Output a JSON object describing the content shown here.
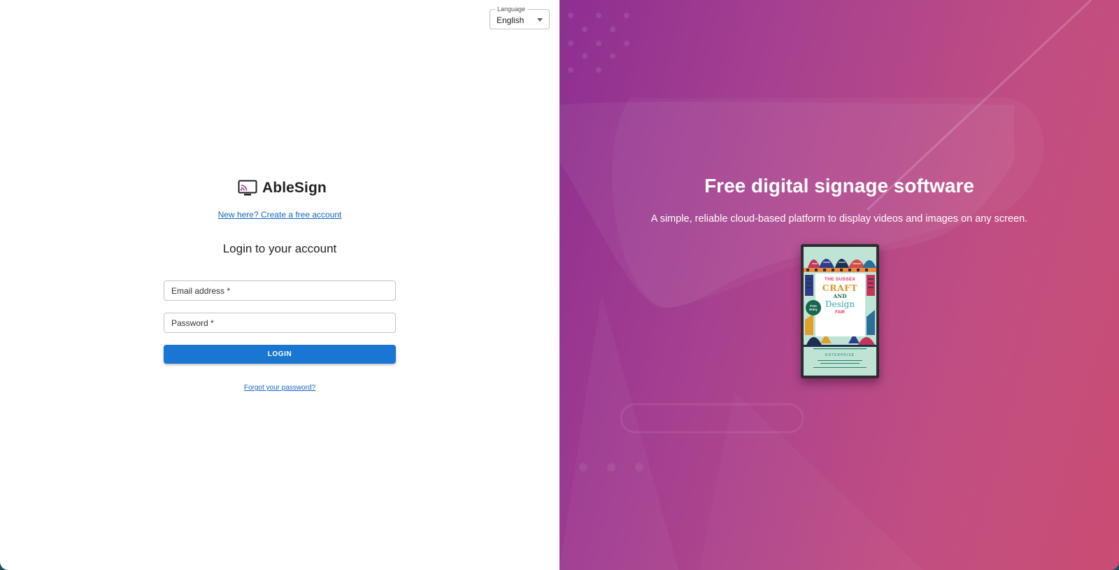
{
  "language": {
    "legend": "Language",
    "selected": "English"
  },
  "brand": {
    "name": "AbleSign",
    "icon": "cast-screen-icon"
  },
  "login": {
    "signup_link": "New here? Create a free account",
    "title": "Login to your account",
    "email_placeholder": "Email address *",
    "password_placeholder": "Password *",
    "button_label": "LOGIN",
    "forgot_link": "Forgot your password?"
  },
  "hero": {
    "title": "Free digital signage software",
    "subtitle": "A simple, reliable cloud-based platform to display videos and images on any screen."
  },
  "poster": {
    "line1": "THE SUSSEX",
    "line2": "CRAFT",
    "line3": "AND",
    "line4": "Design",
    "line5": "FAIR",
    "badge_line1": "Free",
    "badge_line2": "Entry",
    "footer": "ENTERPRISE"
  },
  "colors": {
    "primary": "#1976d2",
    "link": "#1565c0",
    "hero_gradient_start": "#8d2f92",
    "hero_gradient_end": "#c94d73"
  }
}
